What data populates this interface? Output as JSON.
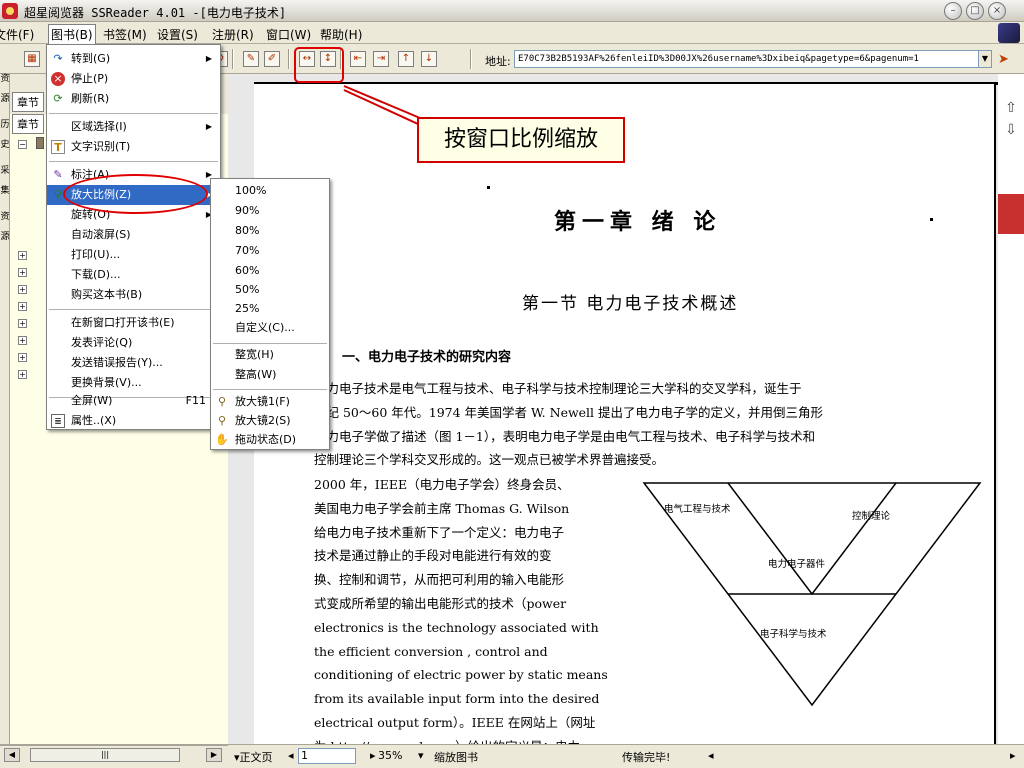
{
  "window": {
    "title": "超星阅览器 SSReader 4.01 -[电力电子技术]",
    "buttons": {
      "minimize": "–",
      "restore": "□",
      "close": "×"
    }
  },
  "menubar": {
    "items": [
      {
        "label": "文件(F)"
      },
      {
        "label": "图书(B)"
      },
      {
        "label": "书签(M)"
      },
      {
        "label": "设置(S)"
      },
      {
        "label": "注册(R)"
      },
      {
        "label": "窗口(W)"
      },
      {
        "label": "帮助(H)"
      }
    ]
  },
  "toolbar": {
    "address_label": "地址:",
    "address_value": "E70C73B2B5193AF%26fenleiID%3D00JX%26username%3Dxibeiq&pagetype=6&pagenum=1"
  },
  "callout": {
    "text": "按窗口比例缩放"
  },
  "sidebar": {
    "tabs": [
      "章节",
      "章节"
    ],
    "vertical_tabs": [
      "资",
      "源",
      "历",
      "史",
      "采",
      "集",
      "资",
      "源"
    ]
  },
  "book_menu": {
    "items": [
      {
        "label": "转到(G)",
        "icon": "goto-icon",
        "submenu": true
      },
      {
        "label": "停止(P)",
        "icon": "stop-icon"
      },
      {
        "label": "刷新(R)",
        "icon": "refresh-icon"
      },
      {
        "label": "区域选择(I)",
        "submenu": true
      },
      {
        "label": "文字识别(T)",
        "icon": "text-recognition-icon"
      },
      {
        "label": "标注(A)",
        "icon": "annotate-icon",
        "submenu": true
      },
      {
        "label": "放大比例(Z)",
        "icon": "zoom-icon",
        "submenu": true,
        "highlighted": true
      },
      {
        "label": "旋转(O)",
        "submenu": true
      },
      {
        "label": "自动滚屏(S)"
      },
      {
        "label": "打印(U)..."
      },
      {
        "label": "下载(D)..."
      },
      {
        "label": "购买这本书(B)"
      },
      {
        "label": "在新窗口打开该书(E)"
      },
      {
        "label": "发表评论(Q)"
      },
      {
        "label": "发送错误报告(Y)..."
      },
      {
        "label": "更换背景(V)..."
      },
      {
        "label": "全屏(W)",
        "shortcut": "F11"
      },
      {
        "label": "属性..(X)",
        "icon": "properties-icon"
      }
    ]
  },
  "zoom_submenu": {
    "items": [
      {
        "label": "100%"
      },
      {
        "label": "90%"
      },
      {
        "label": "80%"
      },
      {
        "label": "70%"
      },
      {
        "label": "60%"
      },
      {
        "label": "50%"
      },
      {
        "label": "25%"
      },
      {
        "label": "自定义(C)..."
      },
      {
        "label": "整宽(H)"
      },
      {
        "label": "整高(W)"
      },
      {
        "label": "放大镜1(F)",
        "icon": "magnifier-icon"
      },
      {
        "label": "放大镜2(S)",
        "icon": "magnifier-icon"
      },
      {
        "label": "拖动状态(D)",
        "icon": "hand-icon"
      }
    ]
  },
  "document": {
    "chapter_title": "第一章  绪   论",
    "section_title": "第一节   电力电子技术概述",
    "subsection_title": "一、电力电子技术的研究内容",
    "paragraph1": [
      "    电力电子技术是电气工程与技术、电子科学与技术控制理论三大学科的交叉学科，诞生于",
      "世纪 50～60 年代。1974 年美国学者 W. Newell 提出了电力电子学的定义，并用倒三角形",
      "电力电子学做了描述（图 1－1），表明电力电子学是由电气工程与技术、电子科学与技术和",
      "控制理论三个学科交叉形成的。这一观点已被学术界普遍接受。"
    ],
    "paragraph2": [
      "    2000 年，IEEE（电力电子学会）终身会员、",
      "美国电力电子学会前主席 Thomas G. Wilson",
      "给电力电子技术重新下了一个定义：电力电子",
      "技术是通过静止的手段对电能进行有效的变",
      "换、控制和调节，从而把可利用的输入电能形",
      "式变成所希望的输出电能形式的技术（power",
      "electronics is the technology associated with",
      "the   efficient   conversion   ,   control   and",
      "conditioning of electric power by static means",
      "from its available input form into the desired",
      "electrical output form）。IEEE 在网站上（网址",
      "为 http://www.pels.org）给出的定义是：电力"
    ],
    "diagram": {
      "top_left": "电气工程与技术",
      "top_right": "控制理论",
      "center": "电力电子器件",
      "bottom": "电子科学与技术"
    }
  },
  "statusbar": {
    "page_type": "正文页",
    "page_number": "1",
    "zoom": "35%",
    "mode": "缩放图书",
    "transfer_status": "传输完毕!"
  }
}
